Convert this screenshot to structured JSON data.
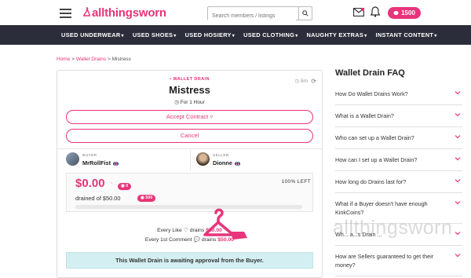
{
  "header": {
    "logo_text": "allthingsworn",
    "search_placeholder": "Search members / listings",
    "coin_balance": "1500"
  },
  "nav": {
    "items": [
      {
        "label": "USED UNDERWEAR"
      },
      {
        "label": "USED SHOES"
      },
      {
        "label": "USED HOSIERY"
      },
      {
        "label": "USED CLOTHING"
      },
      {
        "label": "NAUGHTY EXTRAS"
      },
      {
        "label": "INSTANT CONTENT"
      }
    ]
  },
  "breadcrumb": {
    "home": "Home",
    "sep1": ">",
    "section": "Wallet Drains",
    "sep2": ">",
    "current": "Mistress"
  },
  "drain": {
    "type_label": "WALLET DRAIN",
    "title": "Mistress",
    "timer": "8m",
    "duration": "For 1 Hour",
    "accept_label": "Accept Contract",
    "cancel_label": "Cancel",
    "buyer_role": "BUYER",
    "buyer_name": "MrRollFist",
    "seller_role": "SELLER",
    "seller_name": "Dionne",
    "amount": "$0.00",
    "amount_coins": "0",
    "drained_text": "drained of $50.00",
    "drained_coins": "500",
    "progress_fraction": 0.0,
    "percent_left": "100% LEFT",
    "rule1_prefix": "Every Like",
    "rule1_mid": "drains",
    "rule1_amount": "$50.00",
    "rule2_prefix": "Every 1st Comment",
    "rule2_mid": "drains",
    "rule2_amount": "$50.00",
    "notice": "This Wallet Drain is awaiting approval from the Buyer."
  },
  "faq": {
    "title": "Wallet Drain FAQ",
    "items": [
      {
        "q": "How Do Wallet Drains Work?"
      },
      {
        "q": "What is a Wallet Drain?"
      },
      {
        "q": "Who can set up a Wallet Drain?"
      },
      {
        "q": "How can I set up a Wallet Drain?"
      },
      {
        "q": "How long do Drains last for?"
      },
      {
        "q": "What if a Buyer doesn't have enough KinkCoins?"
      },
      {
        "q": "Wh... a...s Drain ... "
      },
      {
        "q": "How are Sellers guaranteed to get their money?"
      }
    ]
  },
  "watermark": "allthingsworn",
  "colors": {
    "brand_pink": "#e8347a",
    "nav_bg": "#2b2d3a",
    "notice_bg": "#d3eff2"
  }
}
